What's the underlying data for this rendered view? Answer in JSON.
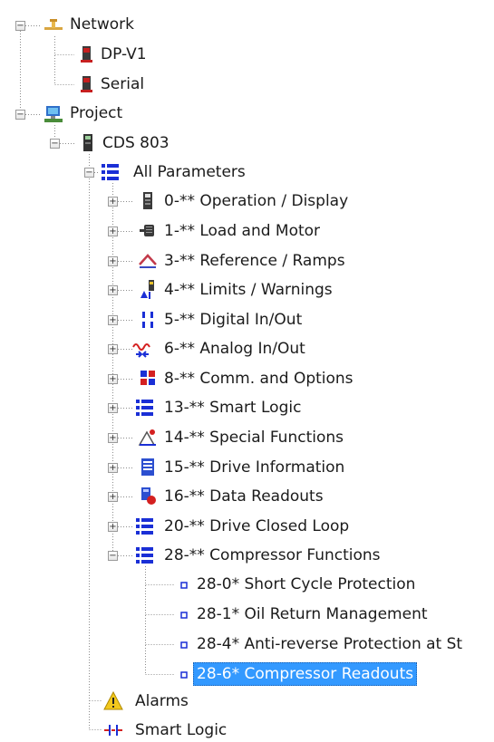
{
  "tree": {
    "network": {
      "label": "Network",
      "expand": "−"
    },
    "dp_v1": {
      "label": "DP-V1"
    },
    "serial": {
      "label": "Serial"
    },
    "project": {
      "label": "Project",
      "expand": "−"
    },
    "cds803": {
      "label": "CDS 803",
      "expand": "−"
    },
    "all_params": {
      "label": "All Parameters",
      "expand": "−"
    },
    "groups": [
      {
        "label": "0-** Operation / Display",
        "expand": "+"
      },
      {
        "label": "1-** Load and Motor",
        "expand": "+"
      },
      {
        "label": "3-** Reference / Ramps",
        "expand": "+"
      },
      {
        "label": "4-** Limits / Warnings",
        "expand": "+"
      },
      {
        "label": "5-** Digital In/Out",
        "expand": "+"
      },
      {
        "label": "6-** Analog In/Out",
        "expand": "+"
      },
      {
        "label": "8-** Comm. and Options",
        "expand": "+"
      },
      {
        "label": "13-** Smart Logic",
        "expand": "+"
      },
      {
        "label": "14-** Special Functions",
        "expand": "+"
      },
      {
        "label": "15-** Drive Information",
        "expand": "+"
      },
      {
        "label": "16-** Data Readouts",
        "expand": "+"
      },
      {
        "label": "20-** Drive Closed Loop",
        "expand": "+"
      },
      {
        "label": "28-** Compressor Functions",
        "expand": "−"
      }
    ],
    "compressor_children": [
      {
        "label": "28-0* Short Cycle Protection"
      },
      {
        "label": "28-1* Oil Return Management"
      },
      {
        "label": "28-4* Anti-reverse Protection at St"
      },
      {
        "label": "28-6* Compressor Readouts",
        "selected": true
      }
    ],
    "alarms": {
      "label": "Alarms"
    },
    "smart_logic": {
      "label": "Smart Logic"
    }
  },
  "colors": {
    "selection": "#3399ff",
    "tree_line": "#8c8c8c",
    "param_blue": "#1a2fd6"
  }
}
